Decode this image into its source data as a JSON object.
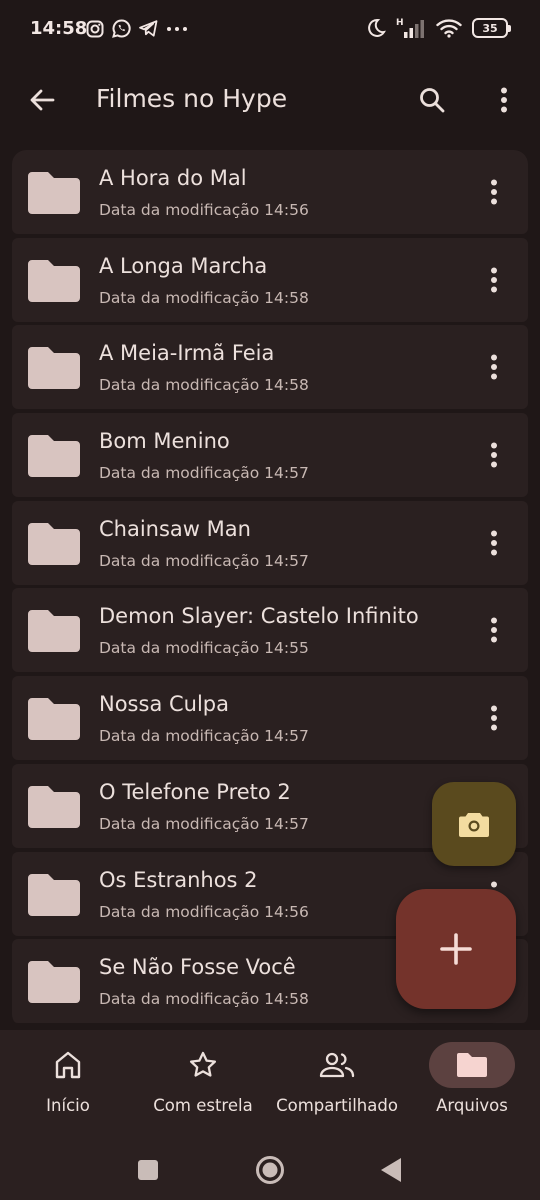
{
  "status_bar": {
    "time": "14:58",
    "left_icons": [
      "instagram-icon",
      "whatsapp-icon",
      "telegram-icon",
      "more-dots-icon"
    ],
    "network_label": "H",
    "battery": "35"
  },
  "app_bar": {
    "title": "Filmes no Hype"
  },
  "files": [
    {
      "name": "A Hora do Mal",
      "meta": "Data da modificação 14:56"
    },
    {
      "name": "A Longa Marcha",
      "meta": "Data da modificação 14:58"
    },
    {
      "name": "A Meia-Irmã Feia",
      "meta": "Data da modificação 14:58"
    },
    {
      "name": "Bom Menino",
      "meta": "Data da modificação 14:57"
    },
    {
      "name": "Chainsaw Man",
      "meta": "Data da modificação 14:57"
    },
    {
      "name": "Demon Slayer: Castelo Infinito",
      "meta": "Data da modificação 14:55"
    },
    {
      "name": "Nossa Culpa",
      "meta": "Data da modificação 14:57"
    },
    {
      "name": "O Telefone Preto 2",
      "meta": "Data da modificação 14:57"
    },
    {
      "name": "Os Estranhos 2",
      "meta": "Data da modificação 14:56"
    },
    {
      "name": "Se Não Fosse Você",
      "meta": "Data da modificação 14:58"
    }
  ],
  "bottom_nav": [
    {
      "label": "Início",
      "icon": "home-icon",
      "active": false
    },
    {
      "label": "Com estrela",
      "icon": "star-icon",
      "active": false
    },
    {
      "label": "Compartilhado",
      "icon": "people-icon",
      "active": false
    },
    {
      "label": "Arquivos",
      "icon": "folder-icon",
      "active": true
    }
  ],
  "colors": {
    "background": "#1f1717",
    "row": "#2a2020",
    "folder": "#d8c4c0",
    "fab_camera": "#5a4a1e",
    "fab_add": "#74332b",
    "nav_active": "#5c4140"
  }
}
